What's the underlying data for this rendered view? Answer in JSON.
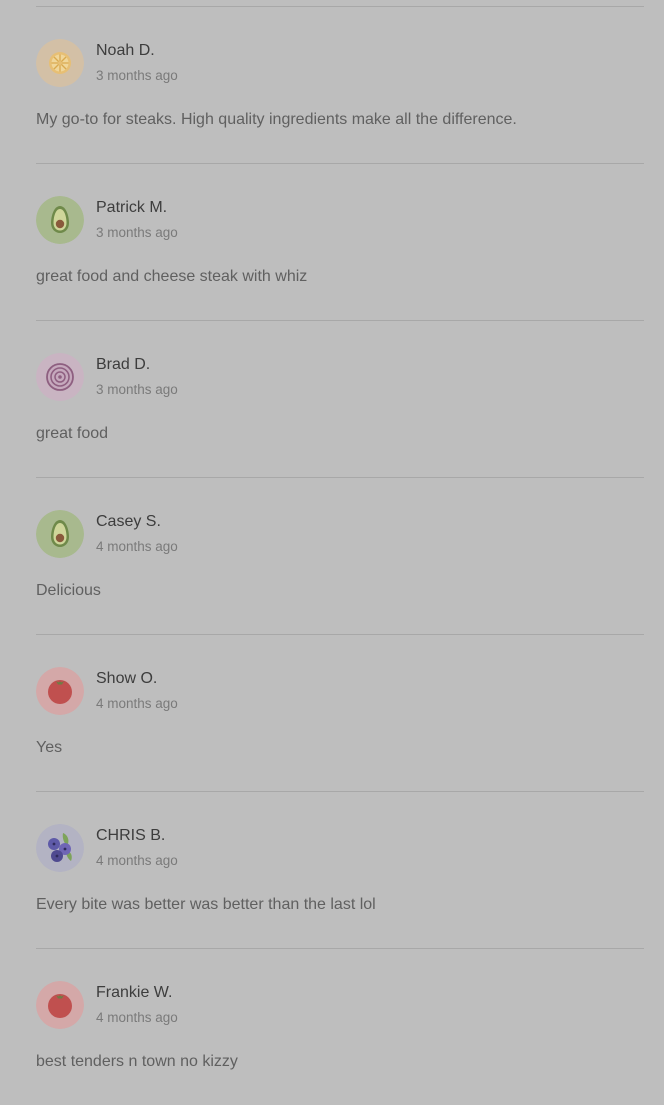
{
  "reviews": [
    {
      "name": "Noah D.",
      "time": "3 months ago",
      "text": "My go-to for steaks. High quality ingredients make all the difference.",
      "avatar_icon": "orange-slice-icon"
    },
    {
      "name": "Patrick M.",
      "time": "3 months ago",
      "text": "great food and cheese steak with whiz",
      "avatar_icon": "avocado-icon"
    },
    {
      "name": "Brad D.",
      "time": "3 months ago",
      "text": "great food",
      "avatar_icon": "onion-icon"
    },
    {
      "name": "Casey S.",
      "time": "4 months ago",
      "text": "Delicious",
      "avatar_icon": "avocado-icon"
    },
    {
      "name": "Show O.",
      "time": "4 months ago",
      "text": "Yes",
      "avatar_icon": "tomato-icon"
    },
    {
      "name": "CHRIS B.",
      "time": "4 months ago",
      "text": "Every bite was better was better than the last lol",
      "avatar_icon": "blueberries-icon"
    },
    {
      "name": "Frankie W.",
      "time": "4 months ago",
      "text": "best tenders n town no kizzy",
      "avatar_icon": "tomato-icon"
    }
  ],
  "colors": {
    "background": "#bebebe",
    "divider": "#a8a8a8",
    "name_text": "#3d3d3d",
    "time_text": "#7a7a7a",
    "body_text": "#606060"
  }
}
